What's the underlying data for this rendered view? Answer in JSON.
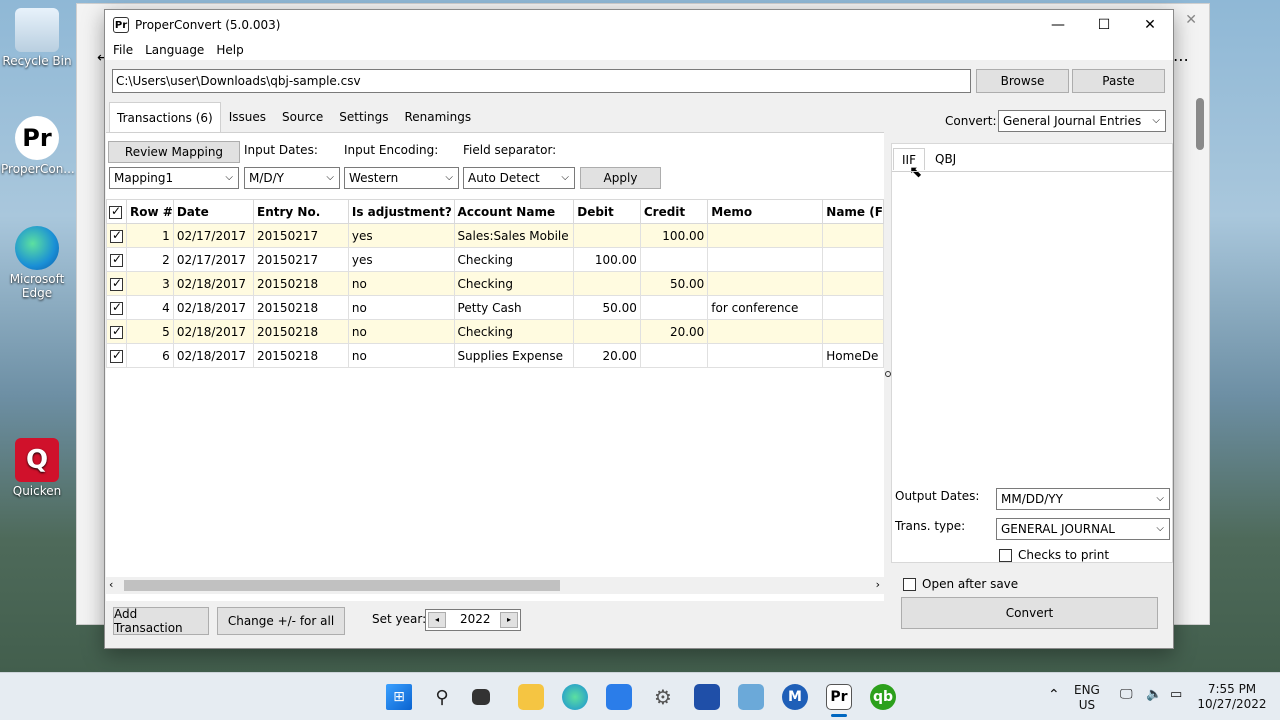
{
  "desktop": {
    "icons": [
      {
        "label": "Recycle Bin"
      },
      {
        "label": "ProperCon..."
      },
      {
        "label": "Microsoft Edge"
      },
      {
        "label": "Quicken"
      }
    ]
  },
  "window": {
    "title": "ProperConvert (5.0.003)",
    "menu": [
      "File",
      "Language",
      "Help"
    ],
    "file_path": "C:\\Users\\user\\Downloads\\qbj-sample.csv",
    "browse_label": "Browse",
    "paste_label": "Paste",
    "convert_label_prefix": "Convert:",
    "convert_type": "General Journal Entries"
  },
  "tabs": [
    "Transactions (6)",
    "Issues",
    "Source",
    "Settings",
    "Renamings"
  ],
  "options": {
    "review_mapping": "Review Mapping",
    "input_dates_label": "Input Dates:",
    "input_encoding_label": "Input Encoding:",
    "field_separator_label": "Field separator:",
    "mapping_value": "Mapping1",
    "dates_value": "M/D/Y",
    "encoding_value": "Western",
    "separator_value": "Auto Detect",
    "apply_label": "Apply"
  },
  "table": {
    "headers": [
      "Row #",
      "Date",
      "Entry No.",
      "Is adjustment?",
      "Account Name",
      "Debit",
      "Credit",
      "Memo",
      "Name (F"
    ],
    "rows": [
      {
        "row": "1",
        "date": "02/17/2017",
        "entry": "20150217",
        "adj": "yes",
        "account": "Sales:Sales Mobile",
        "debit": "",
        "credit": "100.00",
        "memo": "",
        "name": ""
      },
      {
        "row": "2",
        "date": "02/17/2017",
        "entry": "20150217",
        "adj": "yes",
        "account": "Checking",
        "debit": "100.00",
        "credit": "",
        "memo": "",
        "name": ""
      },
      {
        "row": "3",
        "date": "02/18/2017",
        "entry": "20150218",
        "adj": "no",
        "account": "Checking",
        "debit": "",
        "credit": "50.00",
        "memo": "",
        "name": ""
      },
      {
        "row": "4",
        "date": "02/18/2017",
        "entry": "20150218",
        "adj": "no",
        "account": "Petty Cash",
        "debit": "50.00",
        "credit": "",
        "memo": "for conference",
        "name": ""
      },
      {
        "row": "5",
        "date": "02/18/2017",
        "entry": "20150218",
        "adj": "no",
        "account": "Checking",
        "debit": "",
        "credit": "20.00",
        "memo": "",
        "name": ""
      },
      {
        "row": "6",
        "date": "02/18/2017",
        "entry": "20150218",
        "adj": "no",
        "account": "Supplies Expense",
        "debit": "20.00",
        "credit": "",
        "memo": "",
        "name": "HomeDe"
      }
    ]
  },
  "bottom": {
    "add_transaction": "Add Transaction",
    "change_sign": "Change +/- for all",
    "set_year_label": "Set year:",
    "year": "2022"
  },
  "right": {
    "subtabs": [
      "IIF",
      "QBJ"
    ],
    "output_dates_label": "Output Dates:",
    "output_dates_value": "MM/DD/YY",
    "trans_type_label": "Trans. type:",
    "trans_type_value": "GENERAL JOURNAL",
    "checks_to_print": "Checks to print",
    "open_after_save": "Open after save",
    "convert_button": "Convert"
  },
  "taskbar": {
    "lang_line1": "ENG",
    "lang_line2": "US",
    "time": "7:55 PM",
    "date": "10/27/2022"
  }
}
